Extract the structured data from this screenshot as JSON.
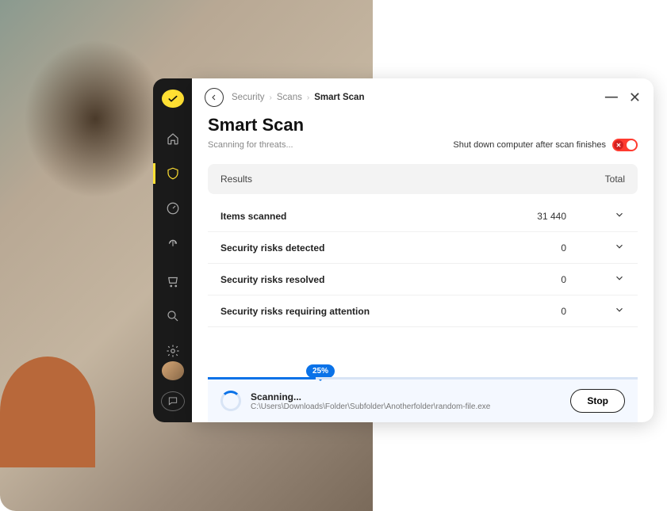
{
  "breadcrumb": {
    "item1": "Security",
    "item2": "Scans",
    "current": "Smart Scan"
  },
  "page": {
    "title": "Smart Scan",
    "status": "Scanning for threats...",
    "shutdown_label": "Shut down computer after scan finishes"
  },
  "results": {
    "header_label": "Results",
    "header_total": "Total",
    "rows": [
      {
        "label": "Items scanned",
        "value": "31 440"
      },
      {
        "label": "Security risks detected",
        "value": "0"
      },
      {
        "label": "Security risks resolved",
        "value": "0"
      },
      {
        "label": "Security risks requiring attention",
        "value": "0"
      }
    ]
  },
  "progress": {
    "percent_label": "25%"
  },
  "scan_footer": {
    "title": "Scanning...",
    "path": "C:\\Users\\Downloads\\Folder\\Subfolder\\Anotherfolder\\random-file.exe",
    "stop_label": "Stop"
  }
}
